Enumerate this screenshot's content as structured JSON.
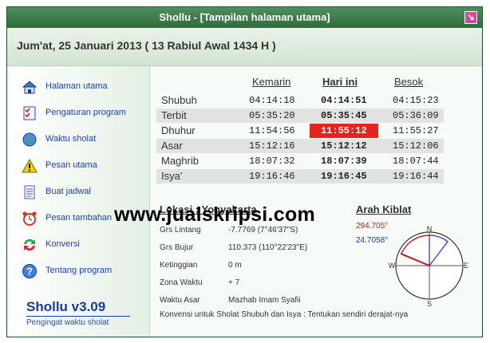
{
  "window": {
    "title": "Shollu - [Tampilan halaman utama]",
    "close_glyph": "↘"
  },
  "date": {
    "text": "Jum'at, 25 Januari 2013 ( 13 Rabiul Awal 1434 H )"
  },
  "sidebar": {
    "items": [
      {
        "label": "Halaman utama",
        "icon": "house-icon"
      },
      {
        "label": "Pengaturan program",
        "icon": "checklist-icon"
      },
      {
        "label": "Waktu sholat",
        "icon": "globe-icon"
      },
      {
        "label": "Pesan utama",
        "icon": "warning-icon"
      },
      {
        "label": "Buat jadwal",
        "icon": "document-icon"
      },
      {
        "label": "Pesan tambahan",
        "icon": "alarm-clock-icon"
      },
      {
        "label": "Konversi",
        "icon": "convert-arrows-icon"
      },
      {
        "label": "Tentang program",
        "icon": "help-icon"
      }
    ],
    "brand_title": "Shollu v3.09",
    "brand_subtitle": "Pengingat waktu sholat"
  },
  "schedule": {
    "headers": {
      "yesterday": "Kemarin",
      "today": "Hari ini",
      "tomorrow": "Besok"
    },
    "rows": [
      {
        "name": "Shubuh",
        "yesterday": "04:14:18",
        "today": "04:14:51",
        "tomorrow": "04:15:23",
        "highlight": false
      },
      {
        "name": "Terbit",
        "yesterday": "05:35:20",
        "today": "05:35:45",
        "tomorrow": "05:36:09",
        "highlight": false
      },
      {
        "name": "Dhuhur",
        "yesterday": "11:54:56",
        "today": "11:55:12",
        "tomorrow": "11:55:27",
        "highlight": true
      },
      {
        "name": "Asar",
        "yesterday": "15:12:16",
        "today": "15:12:12",
        "tomorrow": "15:12:06",
        "highlight": false
      },
      {
        "name": "Maghrib",
        "yesterday": "18:07:32",
        "today": "18:07:39",
        "tomorrow": "18:07:44",
        "highlight": false
      },
      {
        "name": "Isya'",
        "yesterday": "19:16:46",
        "today": "19:16:45",
        "tomorrow": "19:16:44",
        "highlight": false
      }
    ],
    "highlight_color": "#e8221e"
  },
  "location": {
    "title": "Lokasi :  Yogyakarta",
    "fields": [
      {
        "label": "Grs Lintang",
        "value": "-7.7769 (7°46'37\"S)"
      },
      {
        "label": "Grs Bujur",
        "value": "110.373 (110°22'23\"E)"
      },
      {
        "label": "Ketinggian",
        "value": "0 m"
      },
      {
        "label": "Zona Waktu",
        "value": "+ 7"
      },
      {
        "label": "Waktu Asar",
        "value": "Mazhab Imam Syafii"
      }
    ],
    "footnote": "Konvensi untuk Sholat Shubuh dan Isya : Tentukan sendiri derajat-nya"
  },
  "kiblat": {
    "title": "Arah Kiblat",
    "angle_primary": "294.705°",
    "angle_secondary": "24.7058°",
    "compass": {
      "n": "N",
      "s": "S",
      "e": "E",
      "w": "W"
    },
    "primary_color": "#c02020",
    "secondary_color": "#2030c0"
  },
  "watermark": "www.jualskripsi.com"
}
